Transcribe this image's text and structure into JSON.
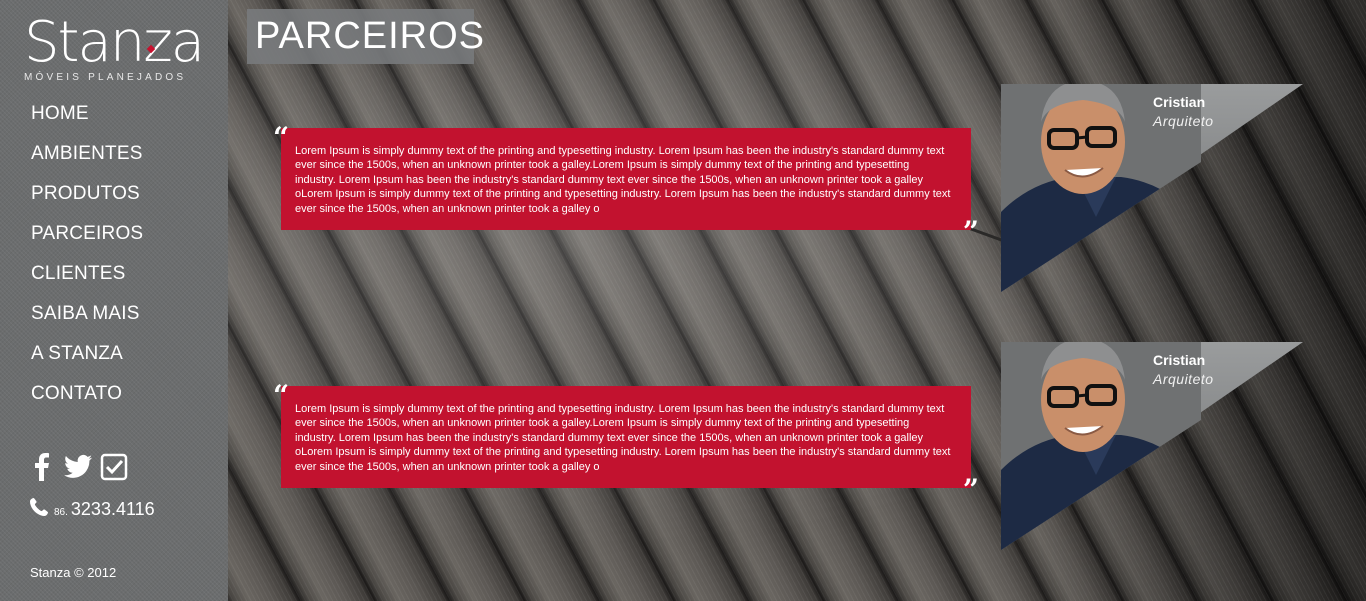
{
  "brand": {
    "name": "Stanza",
    "tagline": "MÓVEIS PLANEJADOS",
    "accent": "#c2122f"
  },
  "nav": [
    {
      "label": "HOME"
    },
    {
      "label": "AMBIENTES"
    },
    {
      "label": "PRODUTOS"
    },
    {
      "label": "PARCEIROS"
    },
    {
      "label": "CLIENTES"
    },
    {
      "label": "SAIBA MAIS"
    },
    {
      "label": "A STANZA"
    },
    {
      "label": "CONTATO"
    }
  ],
  "social": [
    "facebook-icon",
    "twitter-icon",
    "foursquare-icon"
  ],
  "phone": {
    "area": "86.",
    "number": "3233.4116"
  },
  "copyright": "Stanza © 2012",
  "page": {
    "title": "PARCEIROS"
  },
  "testimonials": [
    {
      "text": "Lorem Ipsum is simply dummy text of the printing and typesetting industry. Lorem Ipsum has been the industry's standard dummy text ever since the 1500s, when an unknown printer took a galley.Lorem Ipsum is simply dummy text of the printing and typesetting industry. Lorem Ipsum has been the industry's standard dummy text ever since the 1500s, when an unknown printer took a galley oLorem Ipsum is simply dummy text of the printing and typesetting industry. Lorem Ipsum has been the industry's standard dummy text ever since the 1500s, when an unknown printer took a galley o",
      "name": "Cristian",
      "role": "Arquiteto"
    },
    {
      "text": "Lorem Ipsum is simply dummy text of the printing and typesetting industry. Lorem Ipsum has been the industry's standard dummy text ever since the 1500s, when an unknown printer took a galley.Lorem Ipsum is simply dummy text of the printing and typesetting industry. Lorem Ipsum has been the industry's standard dummy text ever since the 1500s, when an unknown printer took a galley oLorem Ipsum is simply dummy text of the printing and typesetting industry. Lorem Ipsum has been the industry's standard dummy text ever since the 1500s, when an unknown printer took a galley o",
      "name": "Cristian",
      "role": "Arquiteto"
    }
  ]
}
